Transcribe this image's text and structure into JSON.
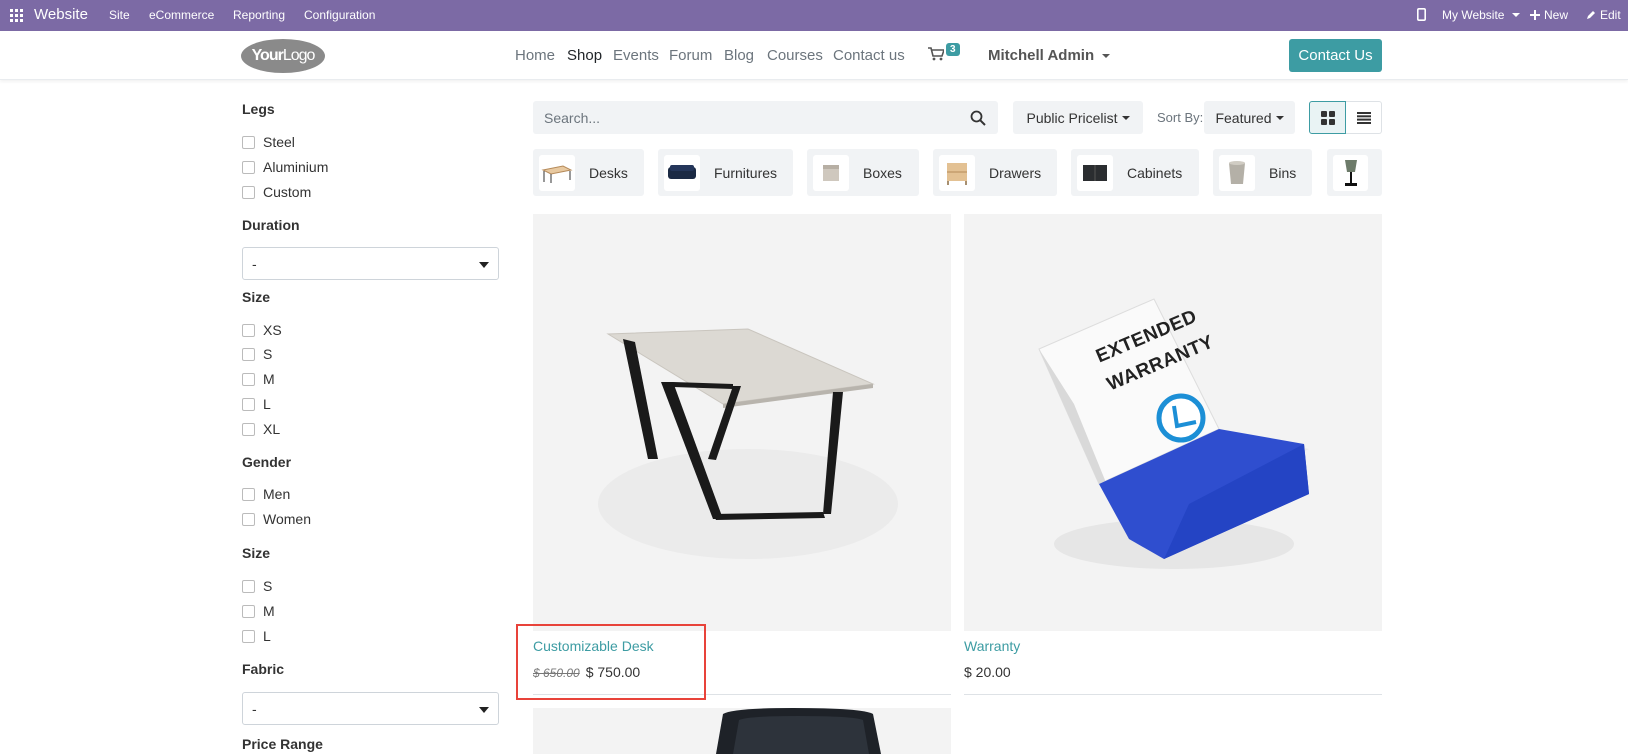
{
  "topbar": {
    "brand": "Website",
    "menus": [
      "Site",
      "eCommerce",
      "Reporting",
      "Configuration"
    ],
    "my_website": "My Website",
    "new": "New",
    "edit": "Edit"
  },
  "header": {
    "logo_part1": "Your",
    "logo_part2": "Logo",
    "nav": [
      "Home",
      "Shop",
      "Events",
      "Forum",
      "Blog",
      "Courses",
      "Contact us"
    ],
    "cart_count": "3",
    "user": "Mitchell Admin",
    "contact_button": "Contact Us"
  },
  "sidebar": {
    "legs_title": "Legs",
    "legs": [
      "Steel",
      "Aluminium",
      "Custom"
    ],
    "duration_title": "Duration",
    "duration_value": "-",
    "size_title": "Size",
    "sizes": [
      "XS",
      "S",
      "M",
      "L",
      "XL"
    ],
    "gender_title": "Gender",
    "genders": [
      "Men",
      "Women"
    ],
    "size2_title": "Size",
    "sizes2": [
      "S",
      "M",
      "L"
    ],
    "fabric_title": "Fabric",
    "fabric_value": "-",
    "price_range_title": "Price Range"
  },
  "toolbar": {
    "search_placeholder": "Search...",
    "pricelist": "Public Pricelist",
    "sort_label": "Sort By:",
    "sort_value": "Featured"
  },
  "categories": [
    "Desks",
    "Furnitures",
    "Boxes",
    "Drawers",
    "Cabinets",
    "Bins"
  ],
  "products": [
    {
      "name": "Customizable Desk",
      "old_price": "$ 650.00",
      "price": "$ 750.00"
    },
    {
      "name": "Warranty",
      "price": "$ 20.00"
    }
  ],
  "warranty_box_text": [
    "EXTENDED",
    "WARRANTY"
  ],
  "colors": {
    "topbar": "#7c6aa5",
    "accent": "#3d9ca3",
    "highlight": "#e8433a"
  }
}
